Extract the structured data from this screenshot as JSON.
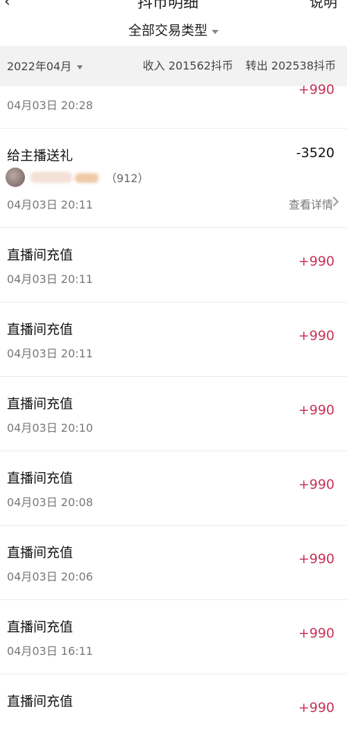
{
  "header": {
    "back_icon": "chevron-left-icon",
    "title_cut": "抖币明细",
    "right_cut": "说明"
  },
  "filter": {
    "label": "全部交易类型"
  },
  "summary": {
    "month": "2022年04月",
    "income": "收入 201562抖币",
    "outgoing": "转出 202538抖币"
  },
  "colors": {
    "positive": "#c8325a",
    "negative": "#111111"
  },
  "list": {
    "top_partial": {
      "time": "04月03日 20:28",
      "amount": "+990"
    },
    "gift": {
      "name": "给主播送礼",
      "amount": "-3520",
      "count": "（912）",
      "time": "04月03日 20:11",
      "detail": "查看详情"
    },
    "items": [
      {
        "name": "直播间充值",
        "time": "04月03日 20:11",
        "amount": "+990"
      },
      {
        "name": "直播间充值",
        "time": "04月03日 20:11",
        "amount": "+990"
      },
      {
        "name": "直播间充值",
        "time": "04月03日 20:10",
        "amount": "+990"
      },
      {
        "name": "直播间充值",
        "time": "04月03日 20:08",
        "amount": "+990"
      },
      {
        "name": "直播间充值",
        "time": "04月03日 20:06",
        "amount": "+990"
      },
      {
        "name": "直播间充值",
        "time": "04月03日 16:11",
        "amount": "+990"
      },
      {
        "name": "直播间充值",
        "time": "",
        "amount": "+990"
      }
    ]
  }
}
